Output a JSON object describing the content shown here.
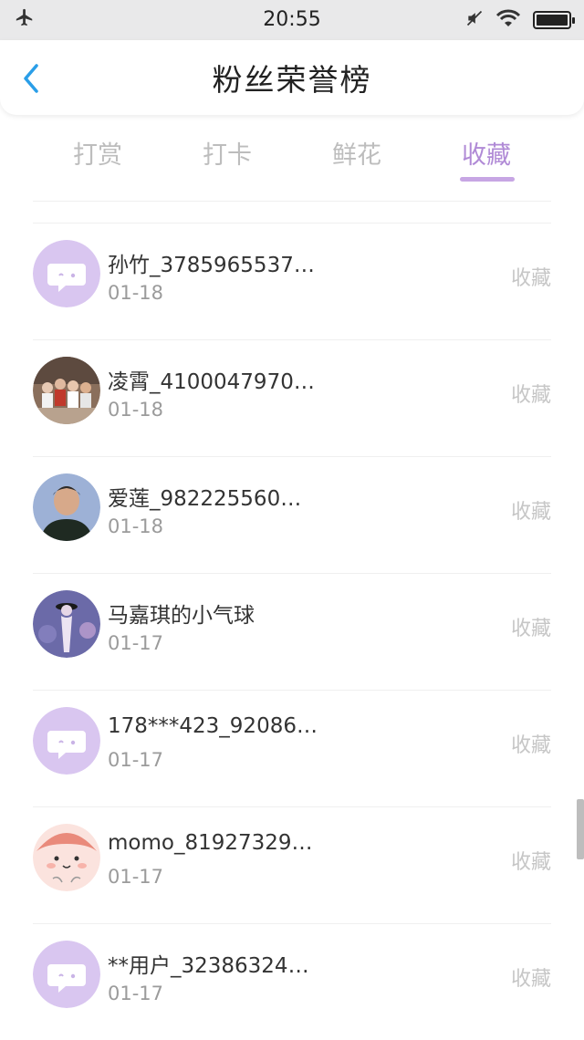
{
  "status_bar": {
    "time": "20:55",
    "left_icon": "airplane-icon",
    "right_icons": [
      "mute-icon",
      "wifi-icon",
      "battery-icon"
    ]
  },
  "header": {
    "title": "粉丝荣誉榜",
    "back_icon": "chevron-left-icon",
    "accent_color": "#2a9ee8"
  },
  "tabs": [
    {
      "label": "打赏",
      "active": false
    },
    {
      "label": "打卡",
      "active": false
    },
    {
      "label": "鲜花",
      "active": false
    },
    {
      "label": "收藏",
      "active": true
    }
  ],
  "colors": {
    "active_tab": "#b08ad6",
    "default_avatar_bg": "#d9c6f0"
  },
  "fans": [
    {
      "name": "孙竹_3785965537…",
      "date": "01-18",
      "action": "收藏",
      "avatar": "default-avatar"
    },
    {
      "name": "凌霄_4100047970…",
      "date": "01-18",
      "action": "收藏",
      "avatar": "group-photo-avatar"
    },
    {
      "name": "爱莲_982225560…",
      "date": "01-18",
      "action": "收藏",
      "avatar": "portrait-photo-avatar"
    },
    {
      "name": "马嘉琪的小气球",
      "date": "01-17",
      "action": "收藏",
      "avatar": "figure-photo-avatar"
    },
    {
      "name": "178***423_92086…",
      "date": "01-17",
      "action": "收藏",
      "avatar": "default-avatar"
    },
    {
      "name": "momo_81927329…",
      "date": "01-17",
      "action": "收藏",
      "avatar": "cartoon-avatar"
    },
    {
      "name": "**用户_32386324…",
      "date": "01-17",
      "action": "收藏",
      "avatar": "default-avatar"
    }
  ]
}
